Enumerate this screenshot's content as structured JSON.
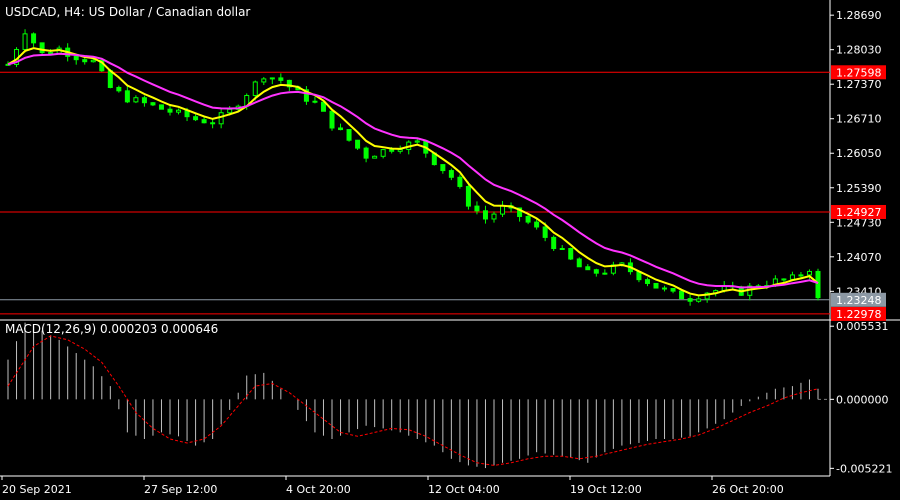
{
  "chart_data": {
    "type": "candlestick",
    "title": "USDCAD, H4:  US Dollar / Canadian dollar",
    "y_ticks": [
      "1.28690",
      "1.28030",
      "1.27370",
      "1.26710",
      "1.26050",
      "1.25390",
      "1.24730",
      "1.24070",
      "1.23410"
    ],
    "ylim": [
      1.229,
      1.2898
    ],
    "x_labels": [
      "20 Sep 2021",
      "27 Sep 12:00",
      "4 Oct 20:00",
      "12 Oct 04:00",
      "19 Oct 12:00",
      "26 Oct 20:00"
    ],
    "price_path": [
      [
        0,
        1.2775
      ],
      [
        2,
        1.284
      ],
      [
        4,
        1.2795
      ],
      [
        6,
        1.2805
      ],
      [
        8,
        1.279
      ],
      [
        10,
        1.278
      ],
      [
        12,
        1.273
      ],
      [
        14,
        1.271
      ],
      [
        16,
        1.27
      ],
      [
        18,
        1.269
      ],
      [
        20,
        1.268
      ],
      [
        22,
        1.267
      ],
      [
        24,
        1.2665
      ],
      [
        26,
        1.2685
      ],
      [
        28,
        1.272
      ],
      [
        30,
        1.2755
      ],
      [
        32,
        1.2745
      ],
      [
        34,
        1.272
      ],
      [
        36,
        1.27
      ],
      [
        38,
        1.266
      ],
      [
        40,
        1.263
      ],
      [
        42,
        1.26
      ],
      [
        44,
        1.261
      ],
      [
        46,
        1.262
      ],
      [
        48,
        1.2625
      ],
      [
        50,
        1.259
      ],
      [
        52,
        1.256
      ],
      [
        54,
        1.251
      ],
      [
        56,
        1.248
      ],
      [
        58,
        1.25
      ],
      [
        60,
        1.2485
      ],
      [
        62,
        1.246
      ],
      [
        64,
        1.243
      ],
      [
        66,
        1.24
      ],
      [
        68,
        1.2375
      ],
      [
        70,
        1.238
      ],
      [
        72,
        1.239
      ],
      [
        74,
        1.237
      ],
      [
        76,
        1.235
      ],
      [
        78,
        1.2335
      ],
      [
        80,
        1.2328
      ],
      [
        82,
        1.234
      ],
      [
        84,
        1.2345
      ],
      [
        86,
        1.234
      ],
      [
        88,
        1.2355
      ],
      [
        90,
        1.236
      ],
      [
        92,
        1.2365
      ],
      [
        94,
        1.2385
      ],
      [
        95,
        1.2325
      ]
    ],
    "ma_fast_color": "#ffff00",
    "ma_slow_color": "#ff33ff",
    "candle_color": "#00ff00",
    "price_lines": [
      {
        "label": "1.27598",
        "value": 1.27598,
        "color": "#ff0000"
      },
      {
        "label": "1.24927",
        "value": 1.24927,
        "color": "#ff0000"
      },
      {
        "label": "1.22978",
        "value": 1.22978,
        "color": "#ff0000"
      }
    ],
    "current_price": {
      "label": "1.23248",
      "value": 1.23248,
      "color": "#8c98a4"
    },
    "macd": {
      "label": "MACD(12,26,9) 0.000203 0.000646",
      "y_ticks": [
        "0.005531",
        "0.000000",
        "-0.005221"
      ],
      "ylim": [
        -0.0058,
        0.00585
      ],
      "histogram_color": "#c0c0c0",
      "signal_color": "#ff0000",
      "histogram_path": [
        [
          0,
          0.003
        ],
        [
          2,
          0.0058
        ],
        [
          4,
          0.0052
        ],
        [
          6,
          0.0045
        ],
        [
          8,
          0.0035
        ],
        [
          10,
          0.0025
        ],
        [
          12,
          0.001
        ],
        [
          14,
          -0.0025
        ],
        [
          16,
          -0.003
        ],
        [
          18,
          -0.0025
        ],
        [
          20,
          -0.0028
        ],
        [
          22,
          -0.0035
        ],
        [
          24,
          -0.003
        ],
        [
          26,
          -0.0008
        ],
        [
          28,
          0.0018
        ],
        [
          30,
          0.002
        ],
        [
          32,
          0.0008
        ],
        [
          34,
          -0.0008
        ],
        [
          36,
          -0.0025
        ],
        [
          38,
          -0.003
        ],
        [
          40,
          -0.0025
        ],
        [
          42,
          -0.002
        ],
        [
          44,
          -0.0022
        ],
        [
          46,
          -0.0025
        ],
        [
          48,
          -0.003
        ],
        [
          50,
          -0.0035
        ],
        [
          52,
          -0.0045
        ],
        [
          54,
          -0.005
        ],
        [
          56,
          -0.0052
        ],
        [
          58,
          -0.0048
        ],
        [
          60,
          -0.0045
        ],
        [
          62,
          -0.004
        ],
        [
          64,
          -0.0042
        ],
        [
          66,
          -0.0044
        ],
        [
          68,
          -0.0048
        ],
        [
          70,
          -0.004
        ],
        [
          72,
          -0.0035
        ],
        [
          74,
          -0.0033
        ],
        [
          76,
          -0.003
        ],
        [
          78,
          -0.003
        ],
        [
          80,
          -0.0028
        ],
        [
          82,
          -0.0022
        ],
        [
          84,
          -0.0015
        ],
        [
          86,
          -0.0005
        ],
        [
          88,
          0.0002
        ],
        [
          90,
          0.0008
        ],
        [
          92,
          0.001
        ],
        [
          94,
          0.0015
        ],
        [
          95,
          0.0008
        ]
      ],
      "signal_path": [
        [
          0,
          0.001
        ],
        [
          3,
          0.004
        ],
        [
          5,
          0.0048
        ],
        [
          7,
          0.0045
        ],
        [
          9,
          0.0038
        ],
        [
          11,
          0.0028
        ],
        [
          13,
          0.001
        ],
        [
          15,
          -0.001
        ],
        [
          17,
          -0.0022
        ],
        [
          19,
          -0.003
        ],
        [
          21,
          -0.0033
        ],
        [
          23,
          -0.003
        ],
        [
          25,
          -0.002
        ],
        [
          27,
          -0.0005
        ],
        [
          29,
          0.001
        ],
        [
          31,
          0.0012
        ],
        [
          33,
          0.0005
        ],
        [
          35,
          -0.0005
        ],
        [
          37,
          -0.0015
        ],
        [
          39,
          -0.0025
        ],
        [
          41,
          -0.0028
        ],
        [
          43,
          -0.0025
        ],
        [
          45,
          -0.0022
        ],
        [
          47,
          -0.0023
        ],
        [
          49,
          -0.0028
        ],
        [
          51,
          -0.0035
        ],
        [
          53,
          -0.0042
        ],
        [
          55,
          -0.0048
        ],
        [
          57,
          -0.005
        ],
        [
          59,
          -0.0048
        ],
        [
          61,
          -0.0045
        ],
        [
          63,
          -0.0043
        ],
        [
          65,
          -0.0043
        ],
        [
          67,
          -0.0045
        ],
        [
          69,
          -0.0043
        ],
        [
          71,
          -0.004
        ],
        [
          73,
          -0.0037
        ],
        [
          75,
          -0.0034
        ],
        [
          77,
          -0.0032
        ],
        [
          79,
          -0.003
        ],
        [
          81,
          -0.0027
        ],
        [
          83,
          -0.0022
        ],
        [
          85,
          -0.0016
        ],
        [
          87,
          -0.001
        ],
        [
          89,
          -0.0005
        ],
        [
          91,
          0.0001
        ],
        [
          93,
          0.0005
        ],
        [
          95,
          0.0008
        ]
      ]
    }
  }
}
